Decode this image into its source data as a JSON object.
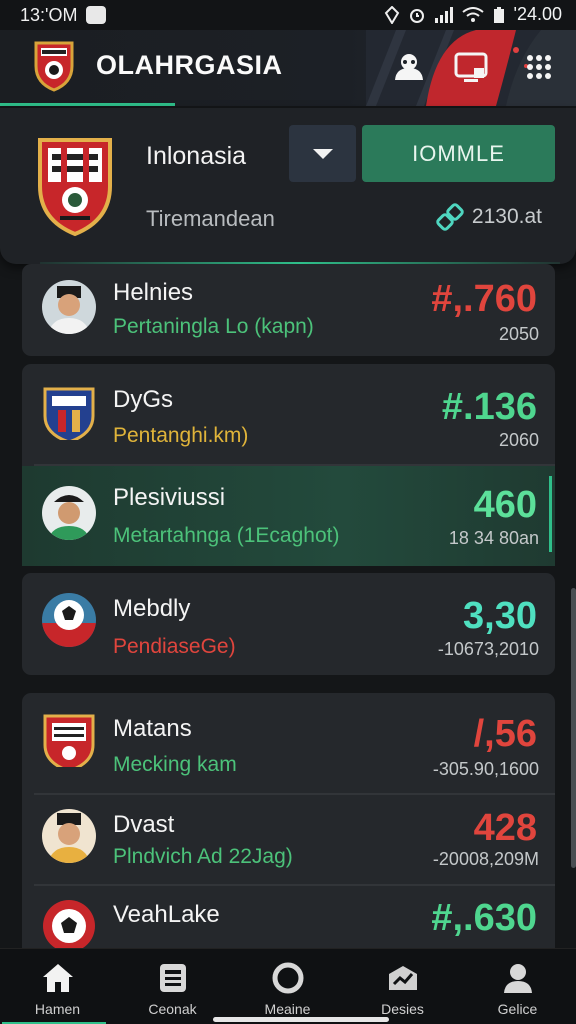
{
  "status_bar": {
    "time": "13:'OM",
    "battery_text": "'24.00"
  },
  "app_bar": {
    "title": "OLAHRGASIA"
  },
  "profile": {
    "name": "Inlonasia",
    "subtitle": "Tiremandean",
    "action_label": "IOMMLE",
    "count": "2130.at"
  },
  "list": {
    "items": [
      {
        "name": "Helnies",
        "subtitle": "Pertaningla Lo (kapn)",
        "value": "#,.760",
        "meta": "2050",
        "subtitle_color": "#4cc27a",
        "value_color": "#e0453d"
      },
      {
        "name": "DyGs",
        "subtitle": "Pentanghi.km)",
        "value": "#.136",
        "meta": "2060",
        "subtitle_color": "#e0b43a",
        "value_color": "#4fd68f"
      },
      {
        "name": "Plesiviussi",
        "subtitle": "Metartahnga (1Ecaghot)",
        "value": "460",
        "meta": "18 34 80an",
        "subtitle_color": "#4cc27a",
        "value_color": "#5ce09a"
      },
      {
        "name": "Mebdly",
        "subtitle": "PendiaseGe)",
        "value": "3,30",
        "meta": "-10673,2010",
        "subtitle_color": "#e0453d",
        "value_color": "#4fe0c0"
      },
      {
        "name": "Matans",
        "subtitle": "Mecking kam",
        "value": "/,56",
        "meta": "-305.90,1600",
        "subtitle_color": "#4cc27a",
        "value_color": "#e0453d"
      },
      {
        "name": "Dvast",
        "subtitle": "Plndvich Ad 22Jag)",
        "value": "428",
        "meta": "-20008,209M",
        "subtitle_color": "#4cc27a",
        "value_color": "#e0453d"
      },
      {
        "name": "VeahLake",
        "subtitle": "",
        "value": "#,.630",
        "meta": "",
        "subtitle_color": "#4cc27a",
        "value_color": "#4fd68f"
      }
    ]
  },
  "bottom_nav": {
    "items": [
      {
        "label": "Hamen",
        "icon": "home-icon"
      },
      {
        "label": "Ceonak",
        "icon": "news-icon"
      },
      {
        "label": "Meaine",
        "icon": "ball-icon"
      },
      {
        "label": "Desies",
        "icon": "chart-icon"
      },
      {
        "label": "Gelice",
        "icon": "profile-icon"
      }
    ]
  },
  "colors": {
    "accent": "#2fbf8a",
    "primary_button": "#2b7a5a",
    "card": "#25282c",
    "negative": "#e0453d",
    "positive": "#4fd68f"
  }
}
